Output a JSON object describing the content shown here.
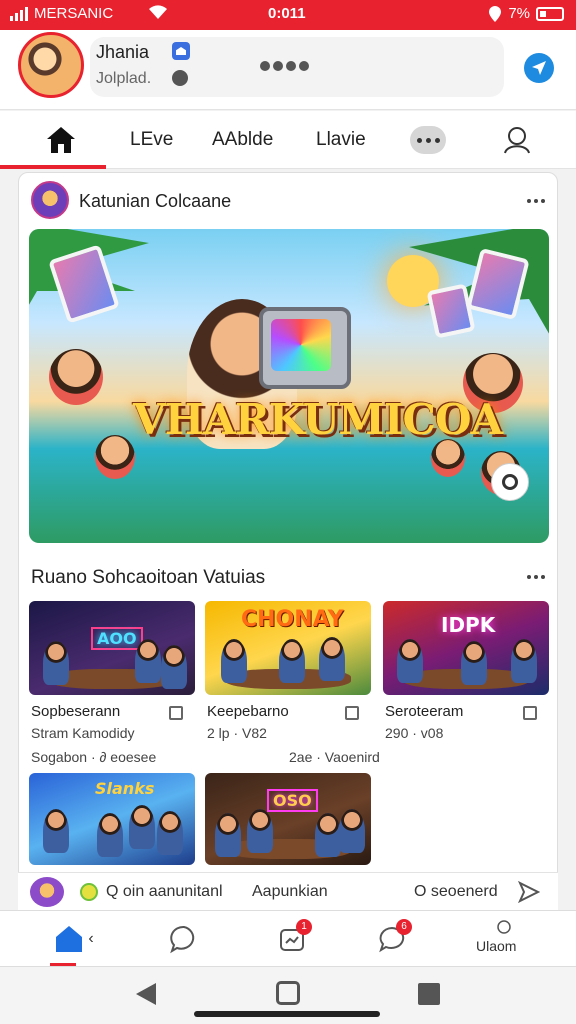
{
  "status_bar": {
    "carrier": "MERSANIC",
    "time": "0:011",
    "battery": "7%"
  },
  "profile": {
    "name": "Jhania",
    "status": "Jolplad."
  },
  "tabs": {
    "live": "LEve",
    "mobile": "AAblde",
    "third": "Llavie"
  },
  "post": {
    "page_name": "Katunian Colcaane",
    "hero_title": "VHARKUMICOA"
  },
  "section": {
    "title": "Ruano Sohcaoitoan Vatuias",
    "videos": [
      {
        "sign": "AOO",
        "title": "Sopbeserann",
        "meta": "Stram Kamodidy"
      },
      {
        "sign": "CHONAY",
        "title": "Keepebarno",
        "meta": "2 lp · V82"
      },
      {
        "sign": "IDPK",
        "title": "Seroteeram",
        "meta": "290 · v08"
      },
      {
        "sign": "Slanks",
        "title": "",
        "meta": ""
      },
      {
        "sign": "OSO",
        "title": "",
        "meta": ""
      }
    ],
    "footer_left": "Sogabon · ∂ eoesee",
    "footer_right": "2ae · Vaoenird"
  },
  "comment_bar": {
    "comment": "Q oin aanunitanl",
    "reply": "Aapunkian",
    "second": "O seoenerd"
  },
  "bottom_nav": {
    "chat_badge": "1",
    "notify_badge": "6",
    "profile_label": "Ulaom"
  },
  "colors": {
    "accent": "#e8222e",
    "share": "#1e8be0"
  }
}
